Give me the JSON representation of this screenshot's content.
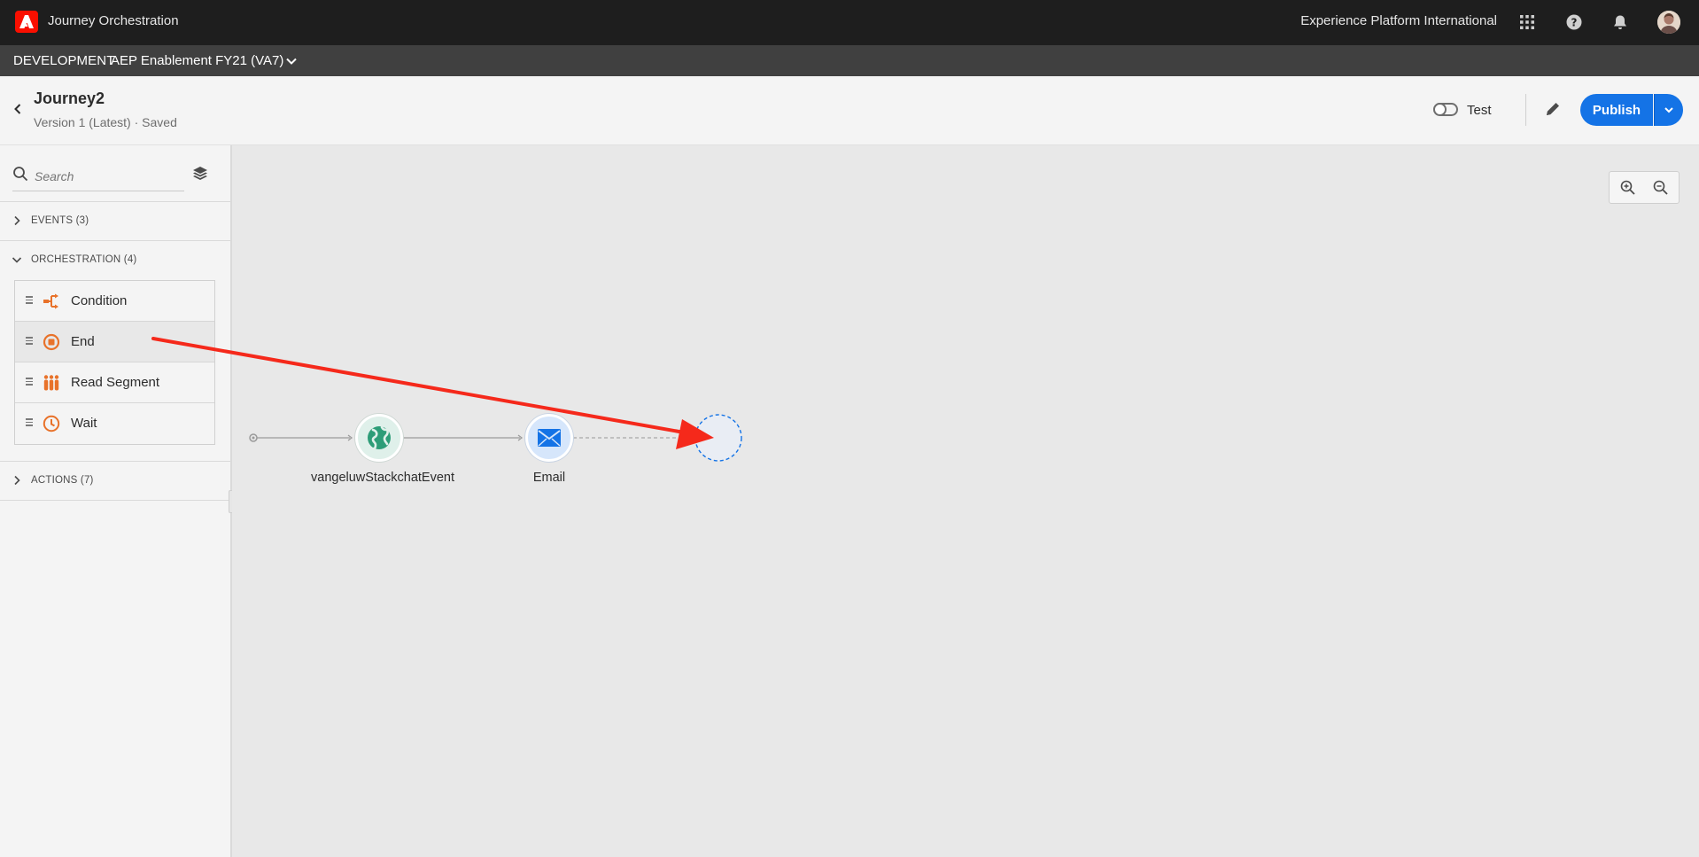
{
  "topbar": {
    "app_title": "Journey Orchestration",
    "org_name": "Experience Platform International",
    "icons": [
      "adobe-logo-icon",
      "app-switcher-icon",
      "help-icon",
      "notification-bell-icon",
      "user-avatar"
    ]
  },
  "sandbox": {
    "environment": "DEVELOPMENT",
    "name": "AEP Enablement FY21 (VA7)"
  },
  "journey": {
    "title": "Journey2",
    "subtitle": "Version 1 (Latest) · Saved",
    "test_label": "Test",
    "test_enabled": false,
    "publish_label": "Publish"
  },
  "panel": {
    "search": {
      "placeholder": "Search",
      "value": ""
    },
    "sections": {
      "events": "EVENTS (3)",
      "orchestration": "ORCHESTRATION (4)",
      "actions": "ACTIONS (7)"
    },
    "orchestration_items": [
      {
        "label": "Condition",
        "icon": "condition-icon"
      },
      {
        "label": "End",
        "icon": "end-icon"
      },
      {
        "label": "Read Segment",
        "icon": "read-segment-icon"
      },
      {
        "label": "Wait",
        "icon": "wait-icon"
      }
    ]
  },
  "canvas": {
    "nodes": [
      {
        "label": "vangeluwStackchatEvent",
        "icon": "globe-icon"
      },
      {
        "label": "Email",
        "icon": "email-icon"
      }
    ]
  },
  "colors": {
    "topbar": "#1e1e1e",
    "sandbox_bar": "#404040",
    "accent_blue": "#1473e6",
    "orchestration_orange": "#e8722a",
    "event_green": "#2d9d78",
    "annotation_red": "#f5291b"
  }
}
